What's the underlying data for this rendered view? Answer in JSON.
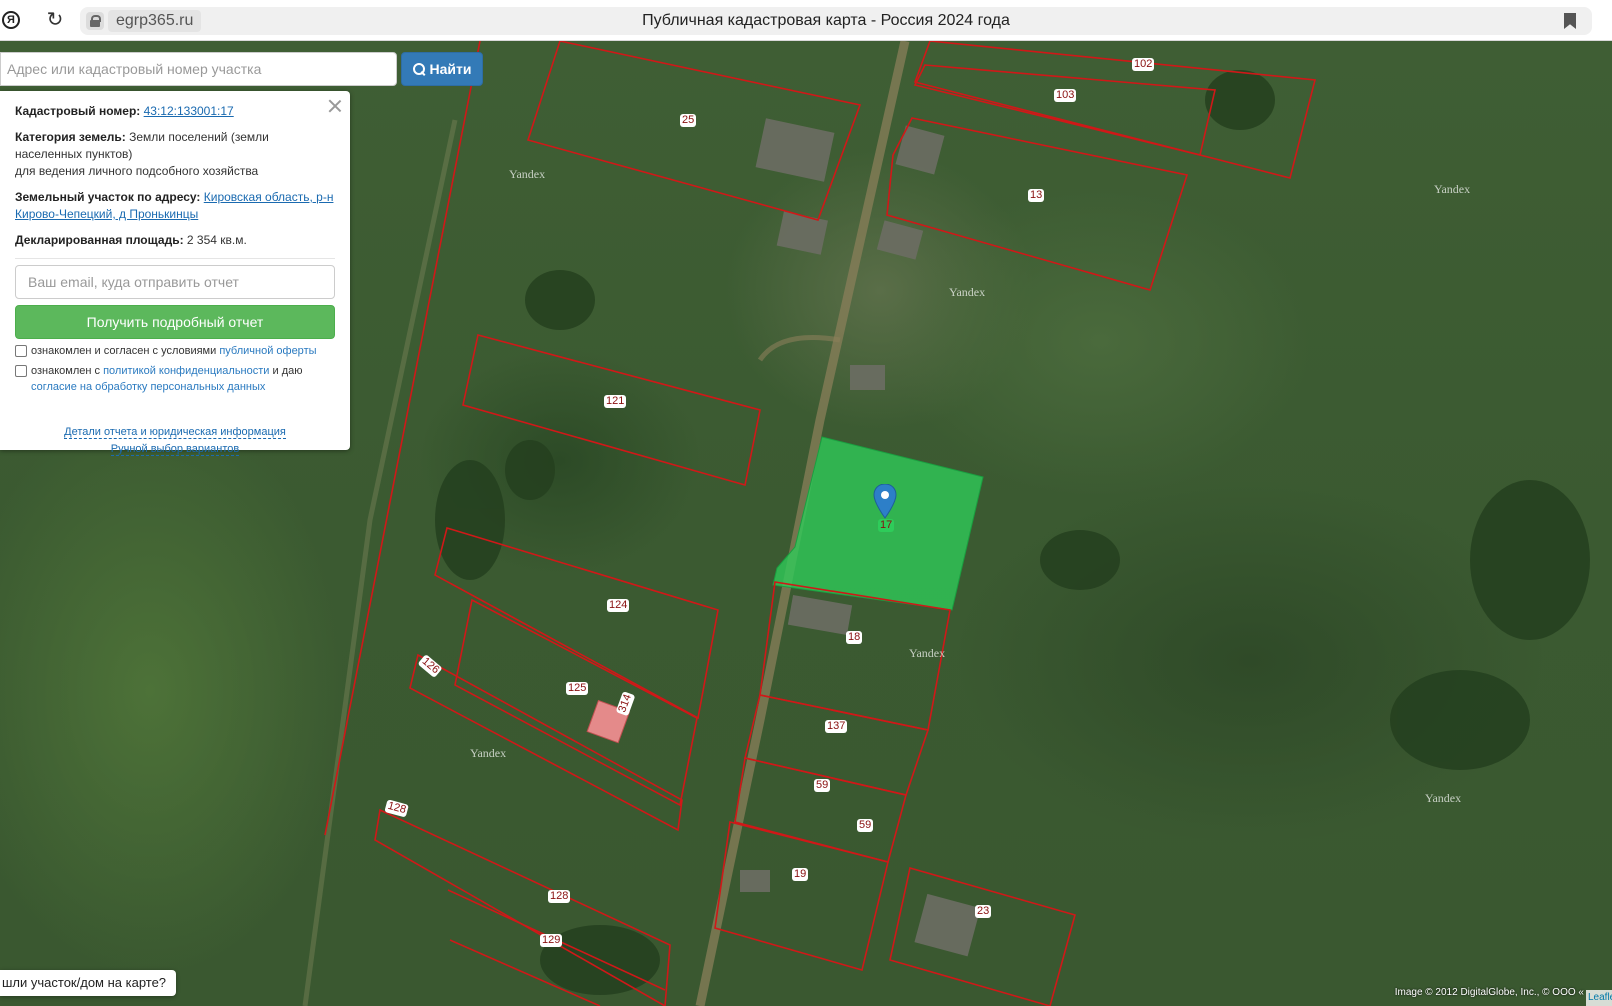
{
  "browser": {
    "domain": "egrp365.ru",
    "title": "Публичная кадастровая карта - Россия 2024 года"
  },
  "search": {
    "placeholder": "Адрес или кадастровый номер участка",
    "button_label": "Найти"
  },
  "info_panel": {
    "cadastral_label": "Кадастровый номер:",
    "cadastral_number": "43:12:133001:17",
    "category_label": "Категория земель:",
    "category_value": "Земли поселений (земли населенных пунктов)",
    "category_use": "для ведения личного подсобного хозяйства",
    "address_label": "Земельный участок по адресу:",
    "address_value": "Кировская область, р-н Кирово-Чепецкий, д Пронькинцы",
    "area_label": "Декларированная площадь:",
    "area_value": "2 354 кв.м.",
    "email_placeholder": "Ваш email, куда отправить отчет",
    "report_button": "Получить подробный отчет",
    "consent1_text": "ознакомлен и согласен с условиями",
    "consent1_link": "публичной оферты",
    "consent2_text_a": "ознакомлен с",
    "consent2_link_a": "политикой конфиденциальности",
    "consent2_text_b": "и даю",
    "consent2_link_b": "согласие на обработку персональных данных",
    "link_details": "Детали отчета и юридическая информация",
    "link_manual": "Ручной выбор вариантов"
  },
  "map": {
    "parcel_labels": [
      "102",
      "103",
      "25",
      "13",
      "121",
      "124",
      "126",
      "125",
      "314",
      "18",
      "137",
      "59",
      "59",
      "19",
      "23",
      "128",
      "128",
      "129",
      "17"
    ],
    "watermark": "Yandex",
    "highlight_color": "#2ecc5a",
    "boundary_color": "#cc1111"
  },
  "bottom": {
    "found_button": "шли участок/дом на карте?",
    "attribution": "Image © 2012 DigitalGlobe, Inc., © ООО «",
    "leaflet": "Leaflet"
  }
}
